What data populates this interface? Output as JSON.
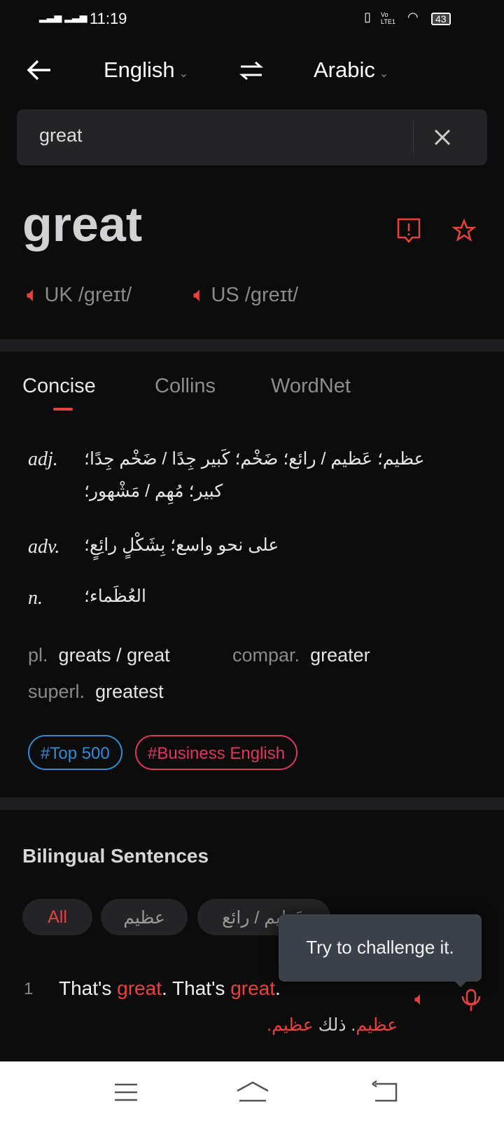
{
  "status_bar": {
    "time": "11:19",
    "battery": "43",
    "volte": "Vo LTE1"
  },
  "header": {
    "back_icon": "arrow-left",
    "source_lang": "English",
    "swap_icon": "swap-arrows",
    "target_lang": "Arabic"
  },
  "search": {
    "value": "great",
    "clear_icon": "close"
  },
  "entry": {
    "headword": "great",
    "uk_label": "UK",
    "uk_ipa": "/greɪt/",
    "us_label": "US",
    "us_ipa": "/greɪt/"
  },
  "tabs": [
    {
      "label": "Concise",
      "active": true
    },
    {
      "label": "Collins"
    },
    {
      "label": "WordNet"
    }
  ],
  "definitions": [
    {
      "pos": "adj.",
      "lines": [
        "عظيم؛ عَظيم / رائع؛ ضَخْم؛ كَبير جِدًا / ضَخْم جِدًا؛",
        "كبير؛ مُهِم / مَشْهور؛"
      ]
    },
    {
      "pos": "adv.",
      "lines": [
        "على نحو واسع؛ بِشَكْلٍ رائِعٍ؛"
      ]
    },
    {
      "pos": "n.",
      "lines": [
        "العُظَماء؛"
      ]
    }
  ],
  "inflections": {
    "pl_label": "pl.",
    "pl": "greats / great",
    "compar_label": "compar.",
    "compar": "greater",
    "superl_label": "superl.",
    "superl": "greatest"
  },
  "tags": [
    {
      "label": "#Top 500",
      "color": "#2a8fd6"
    },
    {
      "label": "#Business English",
      "color": "#e0355f"
    }
  ],
  "sentences": {
    "title": "Bilingual Sentences",
    "filters": [
      "All",
      "عظيم",
      "عَظيم / رائع"
    ],
    "tooltip": "Try to challenge it.",
    "items": [
      {
        "num": "1",
        "en": [
          "That's ",
          "great",
          ". That's ",
          "great",
          "."
        ],
        "ar": [
          "عظيم",
          ". ذلك ",
          "عظيم",
          "."
        ]
      }
    ]
  },
  "colors": {
    "accent": "#e8423f",
    "background": "#0c0c0d"
  }
}
